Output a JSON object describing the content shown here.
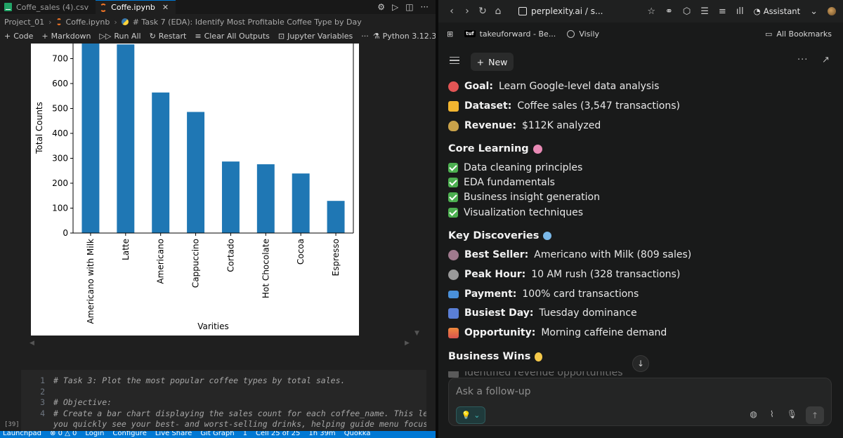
{
  "vscode": {
    "tabs": [
      {
        "label": "Coffe_sales (4).csv",
        "active": false
      },
      {
        "label": "Coffe.ipynb",
        "active": true
      }
    ],
    "breadcrumb": [
      "Project_01",
      "Coffe.ipynb",
      "# Task 7 (EDA): Identify Most Profitable Coffee Type by Day"
    ],
    "toolbar": {
      "code": "Code",
      "markdown": "Markdown",
      "run_all": "Run All",
      "restart": "Restart",
      "clear_outputs": "Clear All Outputs",
      "jupyter_vars": "Jupyter Variables",
      "more": "···",
      "kernel": "Python 3.12.3"
    },
    "code_lines": [
      {
        "n": "1",
        "text": "# Task 3: Plot the most popular coffee types by total sales."
      },
      {
        "n": "2",
        "text": ""
      },
      {
        "n": "3",
        "text": "# Objective:"
      },
      {
        "n": "4",
        "text": "# Create a bar chart displaying the sales count for each coffee_name. This lets"
      },
      {
        "n": "",
        "text": "you quickly see your best- and worst-selling drinks, helping guide menu focus and"
      }
    ],
    "exec_count": "[39]",
    "statusbar": [
      "Launchpad",
      "⊗ 0 △ 0",
      "Login",
      "Configure",
      "Live Share",
      "Git Graph",
      "1",
      "Cell 25 of 25",
      "1h 39m",
      "Quokka"
    ]
  },
  "chart_data": {
    "type": "bar",
    "categories": [
      "Americano with Milk",
      "Latte",
      "Americano",
      "Cappuccino",
      "Cortado",
      "Hot Chocolate",
      "Cocoa",
      "Espresso"
    ],
    "values": [
      809,
      757,
      564,
      486,
      287,
      276,
      239,
      129
    ],
    "xlabel": "Varities",
    "ylabel": "Total Counts",
    "yticks": [
      0,
      100,
      200,
      300,
      400,
      500,
      600,
      700
    ],
    "ylim": [
      0,
      760
    ],
    "color": "#1f77b4",
    "grid": false
  },
  "browser": {
    "url": "perplexity.ai / s...",
    "assistant": "Assistant",
    "bookmarks": [
      "takeuforward - Be...",
      "Visily"
    ],
    "all_bookmarks": "All Bookmarks",
    "new_button": "New",
    "summary": [
      {
        "icon": "target",
        "label": "Goal:",
        "text": " Learn Google-level data analysis",
        "color": "#e25555"
      },
      {
        "icon": "folder",
        "label": "Dataset:",
        "text": " Coffee sales (3,547 transactions)",
        "color": "#f2b530"
      },
      {
        "icon": "money-bag",
        "label": "Revenue:",
        "text": " $112K analyzed",
        "color": "#c9a24a"
      }
    ],
    "core_heading": "Core Learning",
    "core_items": [
      "Data cleaning principles",
      "EDA fundamentals",
      "Business insight generation",
      "Visualization techniques"
    ],
    "key_heading": "Key Discoveries",
    "key_items": [
      {
        "icon": "coffee",
        "label": "Best Seller:",
        "text": " Americano with Milk (809 sales)",
        "color": "#a07a8e"
      },
      {
        "icon": "clock",
        "label": "Peak Hour:",
        "text": " 10 AM rush (328 transactions)",
        "color": "#9a9a9a"
      },
      {
        "icon": "card",
        "label": "Payment:",
        "text": " 100% card transactions",
        "color": "#4a90d9"
      },
      {
        "icon": "calendar",
        "label": "Busiest Day:",
        "text": " Tuesday dominance",
        "color": "#5a7fd6"
      },
      {
        "icon": "sunrise",
        "label": "Opportunity:",
        "text": " Morning caffeine demand",
        "color": "#f08a3c"
      }
    ],
    "wins_heading": "Business Wins",
    "wins_partial": "Identified revenue opportunities",
    "followup_placeholder": "Ask a follow-up"
  }
}
